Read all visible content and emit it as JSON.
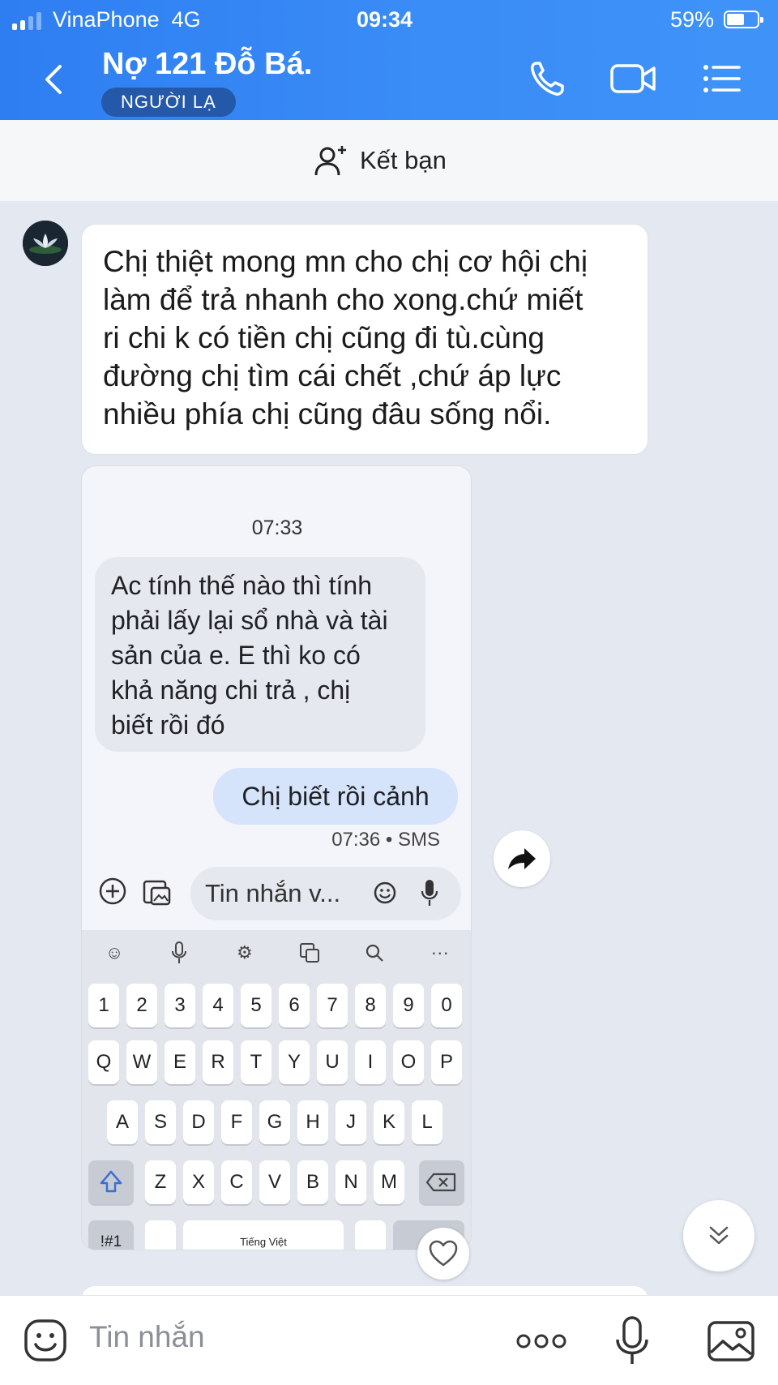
{
  "status_bar": {
    "carrier": "VinaPhone",
    "network": "4G",
    "time": "09:34",
    "battery": "59%",
    "battery_level": 0.59,
    "signal_bars": 2
  },
  "header": {
    "title": "Nợ 121 Đỗ Bá.",
    "badge": "NGƯỜI LẠ",
    "icons": [
      "back-icon",
      "phone-icon",
      "video-call-icon",
      "menu-list-icon"
    ]
  },
  "friend_bar": {
    "label": "Kết bạn",
    "icon": "add-friend-icon"
  },
  "chat": {
    "message": {
      "lines": [
        "Chị thiệt mong mn cho chị cơ hội chị",
        "làm để trả nhanh cho xong.chứ miết",
        "ri chi k có tiền chị cũng đi tù.cùng",
        "đường chị tìm cái chết ,chứ áp lực",
        "nhiều phía chị cũng đâu sống nổi."
      ]
    },
    "screenshot": {
      "time": "07:33",
      "incoming_lines": [
        "Ac tính thế nào thì tính",
        "phải lấy lại sổ nhà và tài",
        "sản của e. E thì ko có",
        "khả năng chi trả , chị",
        "biết rồi đó"
      ],
      "outgoing": "Chị biết rồi cảnh",
      "outgoing_meta": "07:36 • SMS",
      "compose_placeholder": "Tin nhắn v...",
      "keyboard": {
        "numbers": [
          "1",
          "2",
          "3",
          "4",
          "5",
          "6",
          "7",
          "8",
          "9",
          "0"
        ],
        "row1": [
          "Q",
          "W",
          "E",
          "R",
          "T",
          "Y",
          "U",
          "I",
          "O",
          "P"
        ],
        "row2": [
          "A",
          "S",
          "D",
          "F",
          "G",
          "H",
          "J",
          "K",
          "L"
        ],
        "row3": [
          "Z",
          "X",
          "C",
          "V",
          "B",
          "N",
          "M"
        ],
        "bottom_left": "!#1",
        "space_label": "Tiếng Việt"
      }
    }
  },
  "composer": {
    "placeholder": "Tin nhắn"
  },
  "colors": {
    "header_blue": "#3a8cf6",
    "badge_bg": "#2458a8",
    "chat_bg": "#e4e8f1"
  }
}
